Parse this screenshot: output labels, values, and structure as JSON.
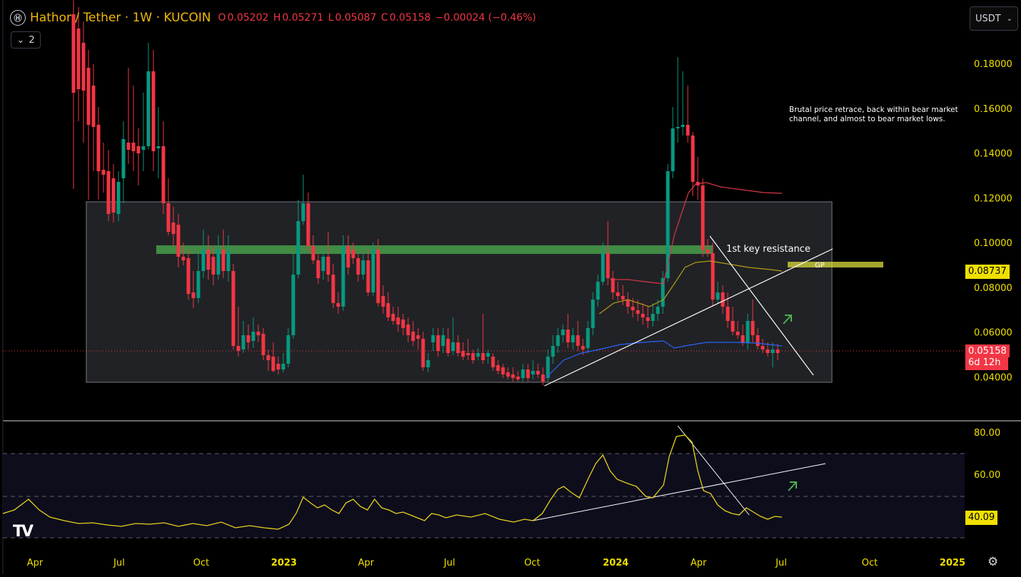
{
  "header": {
    "title": "Hathor / Tether · 1W · KUCOIN",
    "o_label": "O",
    "o_value": "0.05202",
    "h_label": "H",
    "h_value": "0.05271",
    "l_label": "L",
    "l_value": "0.05087",
    "c_label": "C",
    "c_value": "0.05158",
    "change": "−0.00024 (−0.46%)",
    "indicators_count": "2"
  },
  "currency_button": "USDT",
  "price_axis": [
    "0.18000",
    "0.16000",
    "0.14000",
    "0.12000",
    "0.10000",
    "0.08000",
    "0.06000",
    "0.04000"
  ],
  "rsi_axis": [
    "80.00",
    "60.00"
  ],
  "time_axis": [
    "Apr",
    "Jul",
    "Oct",
    "2023",
    "Apr",
    "Jul",
    "Oct",
    "2024",
    "Apr",
    "Jul",
    "Oct",
    "2025"
  ],
  "labels": {
    "ma_value": "0.08737",
    "last_price": "0.05158",
    "countdown": "6d 12h",
    "rsi_value": "40.09"
  },
  "annotations": {
    "note": "Brutal price retrace, back within bear market channel, and almost to bear market lows.",
    "resistance": "1st key resistance",
    "gp": "GP"
  },
  "colors": {
    "up": "#089981",
    "down": "#f23645",
    "accent": "#f0b90b",
    "rsi": "#e6d21e"
  }
}
